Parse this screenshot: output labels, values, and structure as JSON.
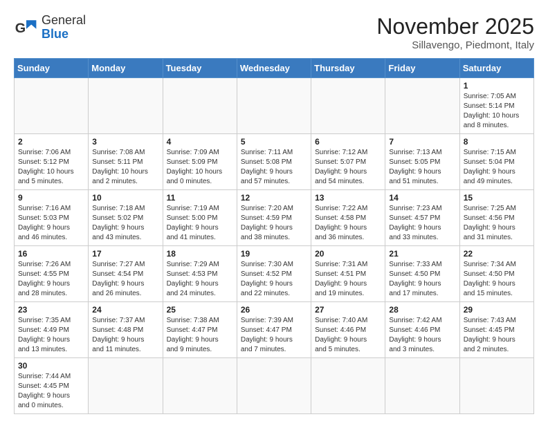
{
  "header": {
    "logo_general": "General",
    "logo_blue": "Blue",
    "month_year": "November 2025",
    "location": "Sillavengo, Piedmont, Italy"
  },
  "weekdays": [
    "Sunday",
    "Monday",
    "Tuesday",
    "Wednesday",
    "Thursday",
    "Friday",
    "Saturday"
  ],
  "weeks": [
    [
      {
        "day": "",
        "info": ""
      },
      {
        "day": "",
        "info": ""
      },
      {
        "day": "",
        "info": ""
      },
      {
        "day": "",
        "info": ""
      },
      {
        "day": "",
        "info": ""
      },
      {
        "day": "",
        "info": ""
      },
      {
        "day": "1",
        "info": "Sunrise: 7:05 AM\nSunset: 5:14 PM\nDaylight: 10 hours\nand 8 minutes."
      }
    ],
    [
      {
        "day": "2",
        "info": "Sunrise: 7:06 AM\nSunset: 5:12 PM\nDaylight: 10 hours\nand 5 minutes."
      },
      {
        "day": "3",
        "info": "Sunrise: 7:08 AM\nSunset: 5:11 PM\nDaylight: 10 hours\nand 2 minutes."
      },
      {
        "day": "4",
        "info": "Sunrise: 7:09 AM\nSunset: 5:09 PM\nDaylight: 10 hours\nand 0 minutes."
      },
      {
        "day": "5",
        "info": "Sunrise: 7:11 AM\nSunset: 5:08 PM\nDaylight: 9 hours\nand 57 minutes."
      },
      {
        "day": "6",
        "info": "Sunrise: 7:12 AM\nSunset: 5:07 PM\nDaylight: 9 hours\nand 54 minutes."
      },
      {
        "day": "7",
        "info": "Sunrise: 7:13 AM\nSunset: 5:05 PM\nDaylight: 9 hours\nand 51 minutes."
      },
      {
        "day": "8",
        "info": "Sunrise: 7:15 AM\nSunset: 5:04 PM\nDaylight: 9 hours\nand 49 minutes."
      }
    ],
    [
      {
        "day": "9",
        "info": "Sunrise: 7:16 AM\nSunset: 5:03 PM\nDaylight: 9 hours\nand 46 minutes."
      },
      {
        "day": "10",
        "info": "Sunrise: 7:18 AM\nSunset: 5:02 PM\nDaylight: 9 hours\nand 43 minutes."
      },
      {
        "day": "11",
        "info": "Sunrise: 7:19 AM\nSunset: 5:00 PM\nDaylight: 9 hours\nand 41 minutes."
      },
      {
        "day": "12",
        "info": "Sunrise: 7:20 AM\nSunset: 4:59 PM\nDaylight: 9 hours\nand 38 minutes."
      },
      {
        "day": "13",
        "info": "Sunrise: 7:22 AM\nSunset: 4:58 PM\nDaylight: 9 hours\nand 36 minutes."
      },
      {
        "day": "14",
        "info": "Sunrise: 7:23 AM\nSunset: 4:57 PM\nDaylight: 9 hours\nand 33 minutes."
      },
      {
        "day": "15",
        "info": "Sunrise: 7:25 AM\nSunset: 4:56 PM\nDaylight: 9 hours\nand 31 minutes."
      }
    ],
    [
      {
        "day": "16",
        "info": "Sunrise: 7:26 AM\nSunset: 4:55 PM\nDaylight: 9 hours\nand 28 minutes."
      },
      {
        "day": "17",
        "info": "Sunrise: 7:27 AM\nSunset: 4:54 PM\nDaylight: 9 hours\nand 26 minutes."
      },
      {
        "day": "18",
        "info": "Sunrise: 7:29 AM\nSunset: 4:53 PM\nDaylight: 9 hours\nand 24 minutes."
      },
      {
        "day": "19",
        "info": "Sunrise: 7:30 AM\nSunset: 4:52 PM\nDaylight: 9 hours\nand 22 minutes."
      },
      {
        "day": "20",
        "info": "Sunrise: 7:31 AM\nSunset: 4:51 PM\nDaylight: 9 hours\nand 19 minutes."
      },
      {
        "day": "21",
        "info": "Sunrise: 7:33 AM\nSunset: 4:50 PM\nDaylight: 9 hours\nand 17 minutes."
      },
      {
        "day": "22",
        "info": "Sunrise: 7:34 AM\nSunset: 4:50 PM\nDaylight: 9 hours\nand 15 minutes."
      }
    ],
    [
      {
        "day": "23",
        "info": "Sunrise: 7:35 AM\nSunset: 4:49 PM\nDaylight: 9 hours\nand 13 minutes."
      },
      {
        "day": "24",
        "info": "Sunrise: 7:37 AM\nSunset: 4:48 PM\nDaylight: 9 hours\nand 11 minutes."
      },
      {
        "day": "25",
        "info": "Sunrise: 7:38 AM\nSunset: 4:47 PM\nDaylight: 9 hours\nand 9 minutes."
      },
      {
        "day": "26",
        "info": "Sunrise: 7:39 AM\nSunset: 4:47 PM\nDaylight: 9 hours\nand 7 minutes."
      },
      {
        "day": "27",
        "info": "Sunrise: 7:40 AM\nSunset: 4:46 PM\nDaylight: 9 hours\nand 5 minutes."
      },
      {
        "day": "28",
        "info": "Sunrise: 7:42 AM\nSunset: 4:46 PM\nDaylight: 9 hours\nand 3 minutes."
      },
      {
        "day": "29",
        "info": "Sunrise: 7:43 AM\nSunset: 4:45 PM\nDaylight: 9 hours\nand 2 minutes."
      }
    ],
    [
      {
        "day": "30",
        "info": "Sunrise: 7:44 AM\nSunset: 4:45 PM\nDaylight: 9 hours\nand 0 minutes."
      },
      {
        "day": "",
        "info": ""
      },
      {
        "day": "",
        "info": ""
      },
      {
        "day": "",
        "info": ""
      },
      {
        "day": "",
        "info": ""
      },
      {
        "day": "",
        "info": ""
      },
      {
        "day": "",
        "info": ""
      }
    ]
  ]
}
